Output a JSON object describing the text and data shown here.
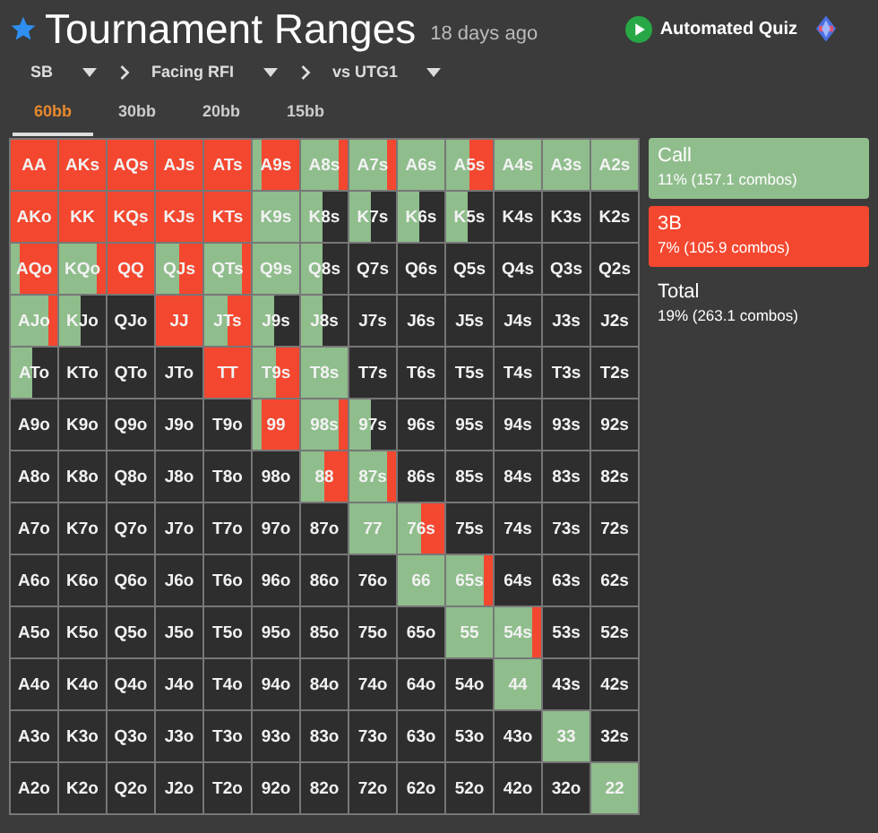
{
  "header": {
    "starred": true,
    "title": "Tournament Ranges",
    "age": "18 days ago",
    "quiz_label": "Automated Quiz"
  },
  "breadcrumb": [
    {
      "label": "SB"
    },
    {
      "label": "Facing RFI"
    },
    {
      "label": "vs UTG1"
    }
  ],
  "tabs": [
    {
      "label": "60bb",
      "selected": true
    },
    {
      "label": "30bb",
      "selected": false
    },
    {
      "label": "20bb",
      "selected": false
    },
    {
      "label": "15bb",
      "selected": false
    }
  ],
  "grid": {
    "rows": [
      [
        {
          "hand": "AA",
          "kind": "raise"
        },
        {
          "hand": "AKs",
          "kind": "raise"
        },
        {
          "hand": "AQs",
          "kind": "raise"
        },
        {
          "hand": "AJs",
          "kind": "raise"
        },
        {
          "hand": "ATs",
          "kind": "raise"
        },
        {
          "hand": "A9s",
          "kind": "raise_mix"
        },
        {
          "hand": "A8s",
          "kind": "call_mix"
        },
        {
          "hand": "A7s",
          "kind": "call_mix"
        },
        {
          "hand": "A6s",
          "kind": "call"
        },
        {
          "hand": "A5s",
          "kind": "even_mix"
        },
        {
          "hand": "A4s",
          "kind": "call"
        },
        {
          "hand": "A3s",
          "kind": "call"
        },
        {
          "hand": "A2s",
          "kind": "call"
        }
      ],
      [
        {
          "hand": "AKo",
          "kind": "raise"
        },
        {
          "hand": "KK",
          "kind": "raise"
        },
        {
          "hand": "KQs",
          "kind": "raise"
        },
        {
          "hand": "KJs",
          "kind": "raise"
        },
        {
          "hand": "KTs",
          "kind": "raise"
        },
        {
          "hand": "K9s",
          "kind": "call"
        },
        {
          "hand": "K8s",
          "kind": "part_call"
        },
        {
          "hand": "K7s",
          "kind": "part_call"
        },
        {
          "hand": "K6s",
          "kind": "part_call"
        },
        {
          "hand": "K5s",
          "kind": "part_call"
        },
        {
          "hand": "K4s",
          "kind": "fold"
        },
        {
          "hand": "K3s",
          "kind": "fold"
        },
        {
          "hand": "K2s",
          "kind": "fold"
        }
      ],
      [
        {
          "hand": "AQo",
          "kind": "raise_mix"
        },
        {
          "hand": "KQo",
          "kind": "call_mix"
        },
        {
          "hand": "QQ",
          "kind": "raise"
        },
        {
          "hand": "QJs",
          "kind": "even_mix"
        },
        {
          "hand": "QTs",
          "kind": "call_mix"
        },
        {
          "hand": "Q9s",
          "kind": "call"
        },
        {
          "hand": "Q8s",
          "kind": "part_call"
        },
        {
          "hand": "Q7s",
          "kind": "fold"
        },
        {
          "hand": "Q6s",
          "kind": "fold"
        },
        {
          "hand": "Q5s",
          "kind": "fold"
        },
        {
          "hand": "Q4s",
          "kind": "fold"
        },
        {
          "hand": "Q3s",
          "kind": "fold"
        },
        {
          "hand": "Q2s",
          "kind": "fold"
        }
      ],
      [
        {
          "hand": "AJo",
          "kind": "call_mix"
        },
        {
          "hand": "KJo",
          "kind": "part_call"
        },
        {
          "hand": "QJo",
          "kind": "fold"
        },
        {
          "hand": "JJ",
          "kind": "raise"
        },
        {
          "hand": "JTs",
          "kind": "even_mix"
        },
        {
          "hand": "J9s",
          "kind": "part_call"
        },
        {
          "hand": "J8s",
          "kind": "part_call"
        },
        {
          "hand": "J7s",
          "kind": "fold"
        },
        {
          "hand": "J6s",
          "kind": "fold"
        },
        {
          "hand": "J5s",
          "kind": "fold"
        },
        {
          "hand": "J4s",
          "kind": "fold"
        },
        {
          "hand": "J3s",
          "kind": "fold"
        },
        {
          "hand": "J2s",
          "kind": "fold"
        }
      ],
      [
        {
          "hand": "ATo",
          "kind": "part_call"
        },
        {
          "hand": "KTo",
          "kind": "fold"
        },
        {
          "hand": "QTo",
          "kind": "fold"
        },
        {
          "hand": "JTo",
          "kind": "fold"
        },
        {
          "hand": "TT",
          "kind": "raise"
        },
        {
          "hand": "T9s",
          "kind": "even_mix"
        },
        {
          "hand": "T8s",
          "kind": "call"
        },
        {
          "hand": "T7s",
          "kind": "fold"
        },
        {
          "hand": "T6s",
          "kind": "fold"
        },
        {
          "hand": "T5s",
          "kind": "fold"
        },
        {
          "hand": "T4s",
          "kind": "fold"
        },
        {
          "hand": "T3s",
          "kind": "fold"
        },
        {
          "hand": "T2s",
          "kind": "fold"
        }
      ],
      [
        {
          "hand": "A9o",
          "kind": "fold"
        },
        {
          "hand": "K9o",
          "kind": "fold"
        },
        {
          "hand": "Q9o",
          "kind": "fold"
        },
        {
          "hand": "J9o",
          "kind": "fold"
        },
        {
          "hand": "T9o",
          "kind": "fold"
        },
        {
          "hand": "99",
          "kind": "raise_mix"
        },
        {
          "hand": "98s",
          "kind": "call_mix"
        },
        {
          "hand": "97s",
          "kind": "part_call"
        },
        {
          "hand": "96s",
          "kind": "fold"
        },
        {
          "hand": "95s",
          "kind": "fold"
        },
        {
          "hand": "94s",
          "kind": "fold"
        },
        {
          "hand": "93s",
          "kind": "fold"
        },
        {
          "hand": "92s",
          "kind": "fold"
        }
      ],
      [
        {
          "hand": "A8o",
          "kind": "fold"
        },
        {
          "hand": "K8o",
          "kind": "fold"
        },
        {
          "hand": "Q8o",
          "kind": "fold"
        },
        {
          "hand": "J8o",
          "kind": "fold"
        },
        {
          "hand": "T8o",
          "kind": "fold"
        },
        {
          "hand": "98o",
          "kind": "fold"
        },
        {
          "hand": "88",
          "kind": "even_mix"
        },
        {
          "hand": "87s",
          "kind": "call_mix"
        },
        {
          "hand": "86s",
          "kind": "fold"
        },
        {
          "hand": "85s",
          "kind": "fold"
        },
        {
          "hand": "84s",
          "kind": "fold"
        },
        {
          "hand": "83s",
          "kind": "fold"
        },
        {
          "hand": "82s",
          "kind": "fold"
        }
      ],
      [
        {
          "hand": "A7o",
          "kind": "fold"
        },
        {
          "hand": "K7o",
          "kind": "fold"
        },
        {
          "hand": "Q7o",
          "kind": "fold"
        },
        {
          "hand": "J7o",
          "kind": "fold"
        },
        {
          "hand": "T7o",
          "kind": "fold"
        },
        {
          "hand": "97o",
          "kind": "fold"
        },
        {
          "hand": "87o",
          "kind": "fold"
        },
        {
          "hand": "77",
          "kind": "call"
        },
        {
          "hand": "76s",
          "kind": "even_mix"
        },
        {
          "hand": "75s",
          "kind": "fold"
        },
        {
          "hand": "74s",
          "kind": "fold"
        },
        {
          "hand": "73s",
          "kind": "fold"
        },
        {
          "hand": "72s",
          "kind": "fold"
        }
      ],
      [
        {
          "hand": "A6o",
          "kind": "fold"
        },
        {
          "hand": "K6o",
          "kind": "fold"
        },
        {
          "hand": "Q6o",
          "kind": "fold"
        },
        {
          "hand": "J6o",
          "kind": "fold"
        },
        {
          "hand": "T6o",
          "kind": "fold"
        },
        {
          "hand": "96o",
          "kind": "fold"
        },
        {
          "hand": "86o",
          "kind": "fold"
        },
        {
          "hand": "76o",
          "kind": "fold"
        },
        {
          "hand": "66",
          "kind": "call"
        },
        {
          "hand": "65s",
          "kind": "call_mix"
        },
        {
          "hand": "64s",
          "kind": "fold"
        },
        {
          "hand": "63s",
          "kind": "fold"
        },
        {
          "hand": "62s",
          "kind": "fold"
        }
      ],
      [
        {
          "hand": "A5o",
          "kind": "fold"
        },
        {
          "hand": "K5o",
          "kind": "fold"
        },
        {
          "hand": "Q5o",
          "kind": "fold"
        },
        {
          "hand": "J5o",
          "kind": "fold"
        },
        {
          "hand": "T5o",
          "kind": "fold"
        },
        {
          "hand": "95o",
          "kind": "fold"
        },
        {
          "hand": "85o",
          "kind": "fold"
        },
        {
          "hand": "75o",
          "kind": "fold"
        },
        {
          "hand": "65o",
          "kind": "fold"
        },
        {
          "hand": "55",
          "kind": "call"
        },
        {
          "hand": "54s",
          "kind": "call_mix"
        },
        {
          "hand": "53s",
          "kind": "fold"
        },
        {
          "hand": "52s",
          "kind": "fold"
        }
      ],
      [
        {
          "hand": "A4o",
          "kind": "fold"
        },
        {
          "hand": "K4o",
          "kind": "fold"
        },
        {
          "hand": "Q4o",
          "kind": "fold"
        },
        {
          "hand": "J4o",
          "kind": "fold"
        },
        {
          "hand": "T4o",
          "kind": "fold"
        },
        {
          "hand": "94o",
          "kind": "fold"
        },
        {
          "hand": "84o",
          "kind": "fold"
        },
        {
          "hand": "74o",
          "kind": "fold"
        },
        {
          "hand": "64o",
          "kind": "fold"
        },
        {
          "hand": "54o",
          "kind": "fold"
        },
        {
          "hand": "44",
          "kind": "call"
        },
        {
          "hand": "43s",
          "kind": "fold"
        },
        {
          "hand": "42s",
          "kind": "fold"
        }
      ],
      [
        {
          "hand": "A3o",
          "kind": "fold"
        },
        {
          "hand": "K3o",
          "kind": "fold"
        },
        {
          "hand": "Q3o",
          "kind": "fold"
        },
        {
          "hand": "J3o",
          "kind": "fold"
        },
        {
          "hand": "T3o",
          "kind": "fold"
        },
        {
          "hand": "93o",
          "kind": "fold"
        },
        {
          "hand": "83o",
          "kind": "fold"
        },
        {
          "hand": "73o",
          "kind": "fold"
        },
        {
          "hand": "63o",
          "kind": "fold"
        },
        {
          "hand": "53o",
          "kind": "fold"
        },
        {
          "hand": "43o",
          "kind": "fold"
        },
        {
          "hand": "33",
          "kind": "call"
        },
        {
          "hand": "32s",
          "kind": "fold"
        }
      ],
      [
        {
          "hand": "A2o",
          "kind": "fold"
        },
        {
          "hand": "K2o",
          "kind": "fold"
        },
        {
          "hand": "Q2o",
          "kind": "fold"
        },
        {
          "hand": "J2o",
          "kind": "fold"
        },
        {
          "hand": "T2o",
          "kind": "fold"
        },
        {
          "hand": "92o",
          "kind": "fold"
        },
        {
          "hand": "82o",
          "kind": "fold"
        },
        {
          "hand": "72o",
          "kind": "fold"
        },
        {
          "hand": "62o",
          "kind": "fold"
        },
        {
          "hand": "52o",
          "kind": "fold"
        },
        {
          "hand": "42o",
          "kind": "fold"
        },
        {
          "hand": "32o",
          "kind": "fold"
        },
        {
          "hand": "22",
          "kind": "call"
        }
      ]
    ]
  },
  "legend": [
    {
      "kind": "call",
      "label": "Call",
      "detail": "11% (157.1 combos)"
    },
    {
      "kind": "raise",
      "label": "3B",
      "detail": "7% (105.9 combos)"
    },
    {
      "kind": "total",
      "label": "Total",
      "detail": "19% (263.1 combos)"
    }
  ]
}
